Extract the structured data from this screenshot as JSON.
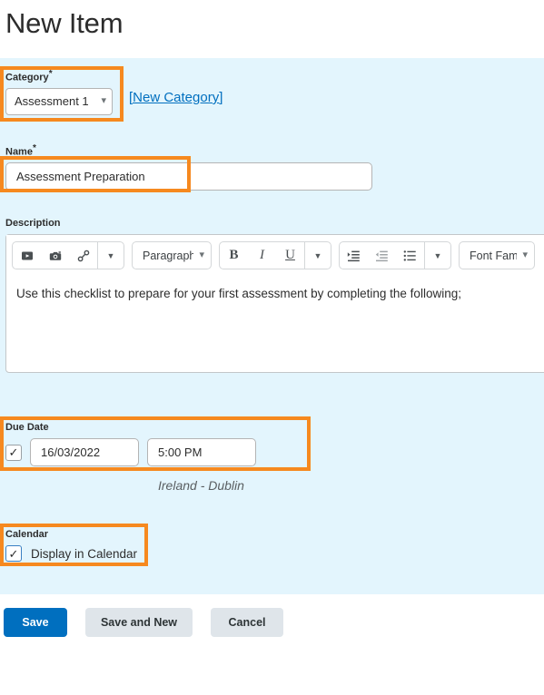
{
  "page": {
    "title": "New Item"
  },
  "category": {
    "label": "Category",
    "required_marker": "*",
    "selected": "Assessment 1",
    "chevron": "chevron-down",
    "new_category_link": "[New Category]"
  },
  "name": {
    "label": "Name",
    "required_marker": "*",
    "value": "Assessment Preparation"
  },
  "description": {
    "label": "Description",
    "body_text": "Use this checklist to prepare for your first assessment by completing the following;",
    "spellcheck_icon": "spellcheck-icon",
    "toolbar": {
      "insert_stuff_icon": "insert-media-icon",
      "image_icon": "camera-icon",
      "link_icon": "link-icon",
      "more_insert_caret": "caret-down",
      "paragraph_format": "Paragraph",
      "bold_label": "B",
      "italic_label": "I",
      "underline_label": "U",
      "more_format_caret": "caret-down",
      "indent_increase_icon": "indent-increase-icon",
      "indent_decrease_icon": "indent-decrease-icon",
      "bullet_list_icon": "bullet-list-icon",
      "more_list_caret": "caret-down",
      "font_family": "Font Family"
    }
  },
  "due_date": {
    "label": "Due Date",
    "checkbox_checked": "✓",
    "date_value": "16/03/2022",
    "time_value": "5:00 PM",
    "timezone_note": "Ireland - Dublin"
  },
  "calendar": {
    "label": "Calendar",
    "checkbox_checked": "✓",
    "option_label": "Display in Calendar"
  },
  "footer": {
    "save_label": "Save",
    "save_and_new_label": "Save and New",
    "cancel_label": "Cancel"
  },
  "colors": {
    "panel_background": "#e3f5fd",
    "highlight_border": "#f6891f",
    "link": "#006fbf",
    "primary_button": "#006fbf",
    "secondary_button": "#dfe5ea"
  }
}
